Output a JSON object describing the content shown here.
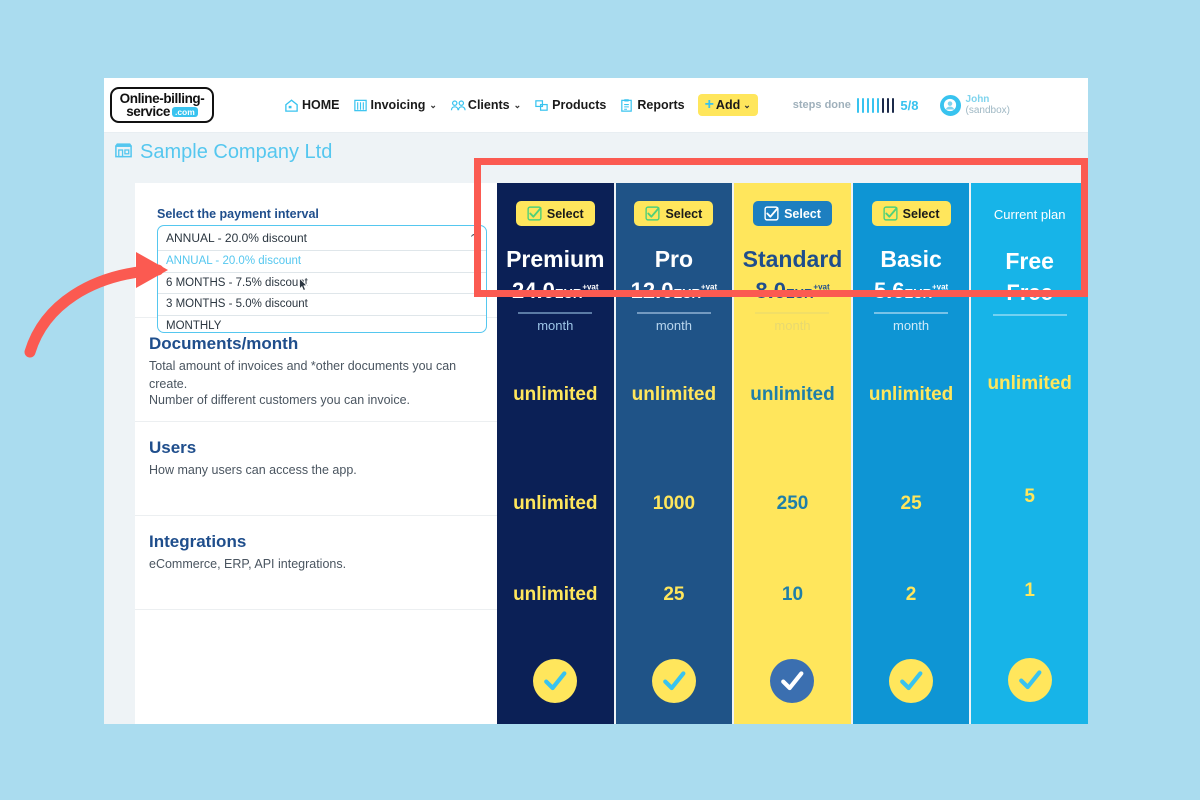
{
  "brand": {
    "logo_line1": "Online-billing-",
    "logo_line2": "service",
    "logo_tld": ".com",
    "accent_cyan": "#38c3ef",
    "accent_yellow": "#ffe65c",
    "annotation_red": "#fb5a51"
  },
  "nav": {
    "items": [
      {
        "label": "HOME",
        "icon": "home-icon",
        "caret": ""
      },
      {
        "label": "Invoicing",
        "icon": "invoicing-icon",
        "caret": "⌄"
      },
      {
        "label": "Clients",
        "icon": "clients-icon",
        "caret": "⌄"
      },
      {
        "label": "Products",
        "icon": "products-icon",
        "caret": ""
      },
      {
        "label": "Reports",
        "icon": "reports-icon",
        "caret": ""
      }
    ],
    "add_button": {
      "label": "Add",
      "plus": "+",
      "caret": "⌄"
    },
    "steps": {
      "label": "steps done",
      "count": "5/8",
      "done": 5,
      "total": 8
    },
    "user": {
      "name": "John",
      "env": "(sandbox)",
      "avatar_icon": "user-avatar-icon"
    }
  },
  "company": {
    "name": "Sample Company Ltd",
    "icon": "company-building-icon"
  },
  "interval": {
    "label": "Select the payment interval",
    "selected": "ANNUAL - 20.0% discount",
    "chevron": "⌃",
    "options": [
      "ANNUAL - 20.0% discount",
      "6 MONTHS - 7.5% discount",
      "3 MONTHS - 5.0% discount",
      "MONTHLY"
    ],
    "highlighted_index": 0
  },
  "features": [
    {
      "title": "",
      "desc": "Number of different customers you can invoice."
    },
    {
      "title": "Documents/month",
      "desc": "Total amount of invoices and *other documents you can create."
    },
    {
      "title": "Users",
      "desc": "How many users can access the app."
    },
    {
      "title": "Integrations",
      "desc": "eCommerce, ERP, API integrations."
    }
  ],
  "plans": [
    {
      "name": "Premium",
      "price": "24.0",
      "currency": "EUR",
      "vat": "+vat",
      "per": "month",
      "action": "Select",
      "action_style": "yellow",
      "bg": "#0b2056",
      "name_color": "#ffffff",
      "price_color": "#ffffff",
      "per_color": "#9ec6e8",
      "value_color": "#ffe65c",
      "customers": "unlimited",
      "documents": "unlimited",
      "users": "unlimited",
      "integrations": "check",
      "tick_bg": "#ffe65c",
      "tick_color": "#38c3ef"
    },
    {
      "name": "Pro",
      "price": "12.0",
      "currency": "EUR",
      "vat": "+vat",
      "per": "month",
      "action": "Select",
      "action_style": "yellow",
      "bg": "#1f5387",
      "name_color": "#ffffff",
      "price_color": "#ffffff",
      "per_color": "#b9d6ee",
      "value_color": "#ffe65c",
      "customers": "unlimited",
      "documents": "1000",
      "users": "25",
      "integrations": "check",
      "tick_bg": "#ffe65c",
      "tick_color": "#38c3ef"
    },
    {
      "name": "Standard",
      "price": "8.0",
      "currency": "EUR",
      "vat": "+vat",
      "per": "month",
      "action": "Select",
      "action_style": "blue",
      "bg": "#ffe65c",
      "name_color": "#1f4e8c",
      "price_color": "#1f4e8c",
      "per_color": "#e8d96f",
      "value_color": "#1f7fa8",
      "customers": "unlimited",
      "documents": "250",
      "users": "10",
      "integrations": "check",
      "tick_bg": "#3b6fb0",
      "tick_color": "#ffffff"
    },
    {
      "name": "Basic",
      "price": "5.6",
      "currency": "EUR",
      "vat": "+vat",
      "per": "month",
      "action": "Select",
      "action_style": "yellow",
      "bg": "#0e95d4",
      "name_color": "#ffffff",
      "price_color": "#ffffff",
      "per_color": "#cfeaf8",
      "value_color": "#ffe65c",
      "customers": "unlimited",
      "documents": "25",
      "users": "2",
      "integrations": "check",
      "tick_bg": "#ffe65c",
      "tick_color": "#38c3ef"
    },
    {
      "name": "Free",
      "price": "Free",
      "currency": "",
      "vat": "",
      "per": "",
      "action": "Current plan",
      "action_style": "current",
      "bg": "#17b4e8",
      "name_color": "#ffffff",
      "price_color": "#ffffff",
      "per_color": "#bfe9f7",
      "value_color": "#ffe65c",
      "customers": "unlimited",
      "documents": "5",
      "users": "1",
      "integrations": "check",
      "tick_bg": "#ffe65c",
      "tick_color": "#38c3ef"
    }
  ]
}
